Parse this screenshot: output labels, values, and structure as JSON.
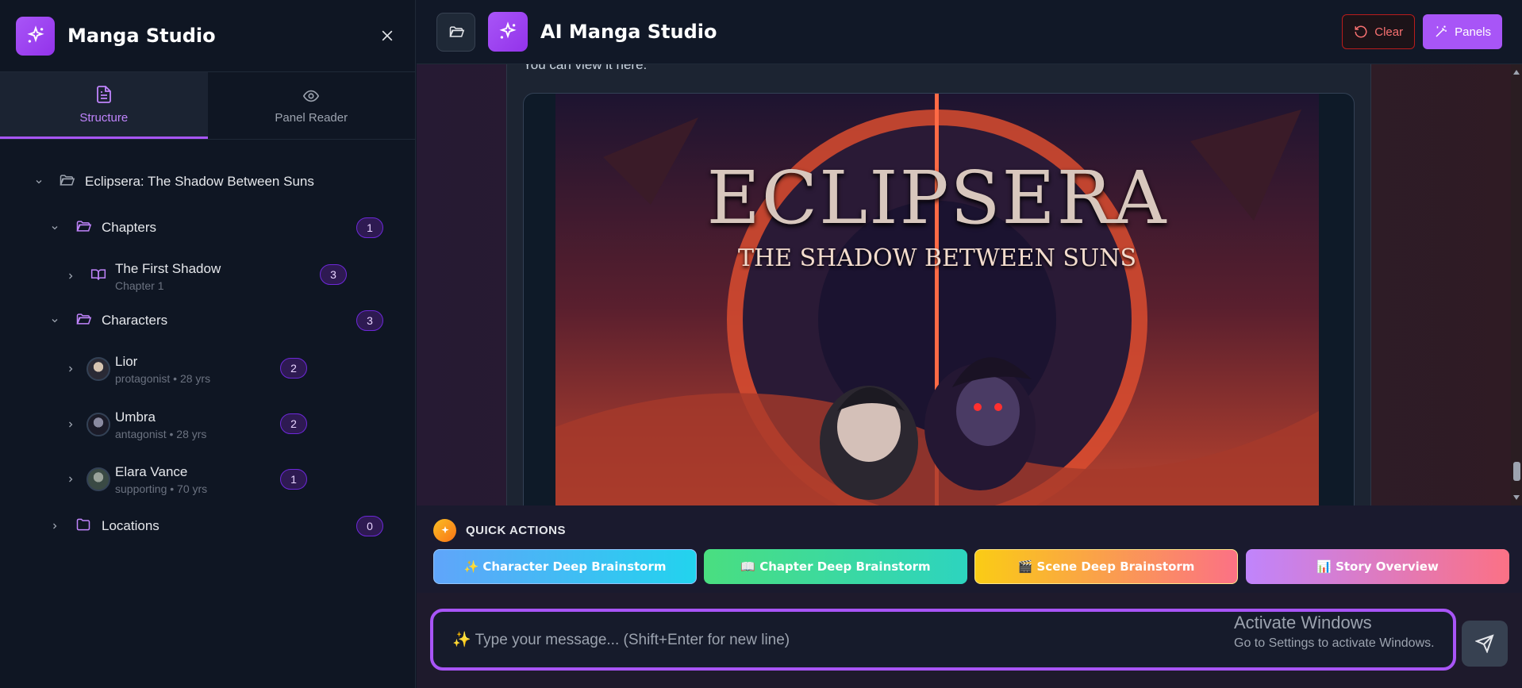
{
  "sidebar": {
    "title": "Manga Studio",
    "tabs": [
      {
        "label": "Structure",
        "icon": "document-icon",
        "active": true
      },
      {
        "label": "Panel Reader",
        "icon": "eye-icon",
        "active": false
      }
    ],
    "tree": {
      "root": "Eclipsera: The Shadow Between Suns",
      "chapters": {
        "label": "Chapters",
        "count": "1",
        "items": [
          {
            "title": "The First Shadow",
            "subtitle": "Chapter 1",
            "count": "3"
          }
        ]
      },
      "characters": {
        "label": "Characters",
        "count": "3",
        "items": [
          {
            "name": "Lior",
            "meta": "protagonist • 28 yrs",
            "count": "2"
          },
          {
            "name": "Umbra",
            "meta": "antagonist • 28 yrs",
            "count": "2"
          },
          {
            "name": "Elara Vance",
            "meta": "supporting • 70 yrs",
            "count": "1"
          }
        ]
      },
      "locations": {
        "label": "Locations",
        "count": "0"
      }
    }
  },
  "header": {
    "title": "AI Manga Studio",
    "clear_label": "Clear",
    "panels_label": "Panels"
  },
  "chat": {
    "partial_text": "You can view it here:",
    "image": {
      "title": "ECLIPSERA",
      "subtitle": "THE SHADOW BETWEEN SUNS"
    }
  },
  "quick_actions": {
    "heading": "QUICK ACTIONS",
    "buttons": [
      {
        "label": "✨ Character Deep Brainstorm"
      },
      {
        "label": "📖 Chapter Deep Brainstorm"
      },
      {
        "label": "🎬 Scene Deep Brainstorm"
      },
      {
        "label": "📊 Story Overview"
      }
    ]
  },
  "composer": {
    "placeholder": "✨ Type your message... (Shift+Enter for new line)"
  },
  "watermark": {
    "line1": "Activate Windows",
    "line2": "Go to Settings to activate Windows."
  },
  "colors": {
    "accent": "#a855f7",
    "danger": "#f87171",
    "background": "#111827"
  }
}
